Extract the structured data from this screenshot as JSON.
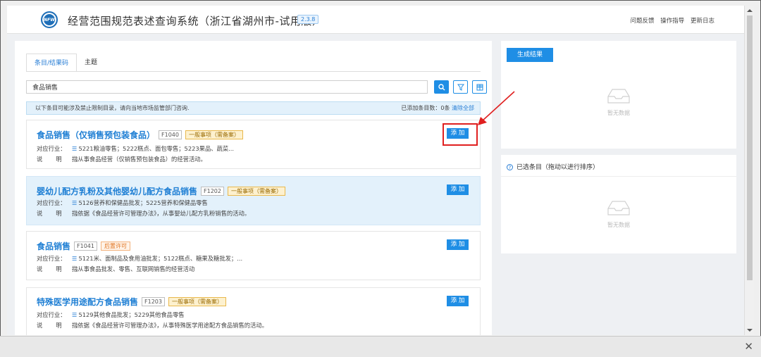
{
  "header": {
    "logo_text": "NFW",
    "title": "经营范围规范表述查询系统（浙江省湖州市-试用版）",
    "version": "2.3.8",
    "links": [
      "问题反馈",
      "操作指导",
      "更新日志"
    ]
  },
  "tabs": [
    {
      "label": "条目/结果码",
      "active": true
    },
    {
      "label": "主题",
      "active": false
    }
  ],
  "search": {
    "value": "食品销售"
  },
  "notice": {
    "text": "以下条目可能涉及禁止限制目录，请向当地市场监管部门咨询.",
    "count_text": "已添加条目数：0条",
    "clear_label": "清除全部"
  },
  "industry_label": "对应行业：",
  "desc_label": "说明：",
  "add_label": "添 加",
  "results": [
    {
      "name": "食品销售（仅销售预包装食品）",
      "code": "F1040",
      "tag": "一般事项（需备案）",
      "tag_type": "yellow",
      "industry": "5221粮油零售；5222糕点、面包零售；5223果品、蔬菜...",
      "desc": "指从事食品经营（仅销售预包装食品）的经营活动。"
    },
    {
      "name": "婴幼儿配方乳粉及其他婴幼儿配方食品销售",
      "code": "F1202",
      "tag": "一般事项（需备案）",
      "tag_type": "yellow",
      "industry": "5126营养和保健品批发；5225营养和保健品零售",
      "desc": "指依据《食品经营许可管理办法》，从事婴幼儿配方乳粉销售的活动。"
    },
    {
      "name": "食品销售",
      "code": "F1041",
      "tag": "后置许可",
      "tag_type": "orange",
      "industry": "5121米、面制品及食用油批发；5122糕点、糖果及糖批发；...",
      "desc": "指从事食品批发、零售、互联网销售的经营活动"
    },
    {
      "name": "特殊医学用途配方食品销售",
      "code": "F1203",
      "tag": "一般事项（需备案）",
      "tag_type": "yellow",
      "industry": "5129其他食品批发；5229其他食品零售",
      "desc": "指依据《食品经营许可管理办法》，从事特殊医学用途配方食品销售的活动。"
    }
  ],
  "result_panel": {
    "generate_label": "生成结果",
    "empty_text": "暂无数据"
  },
  "selected_panel": {
    "title": "已选条目（拖动以进行排序）",
    "empty_text": "暂无数据"
  },
  "colors": {
    "primary": "#1f8ee5",
    "link": "#1f7fd4",
    "highlight_bg": "#e3f1fb",
    "annotation_red": "#e02020"
  }
}
